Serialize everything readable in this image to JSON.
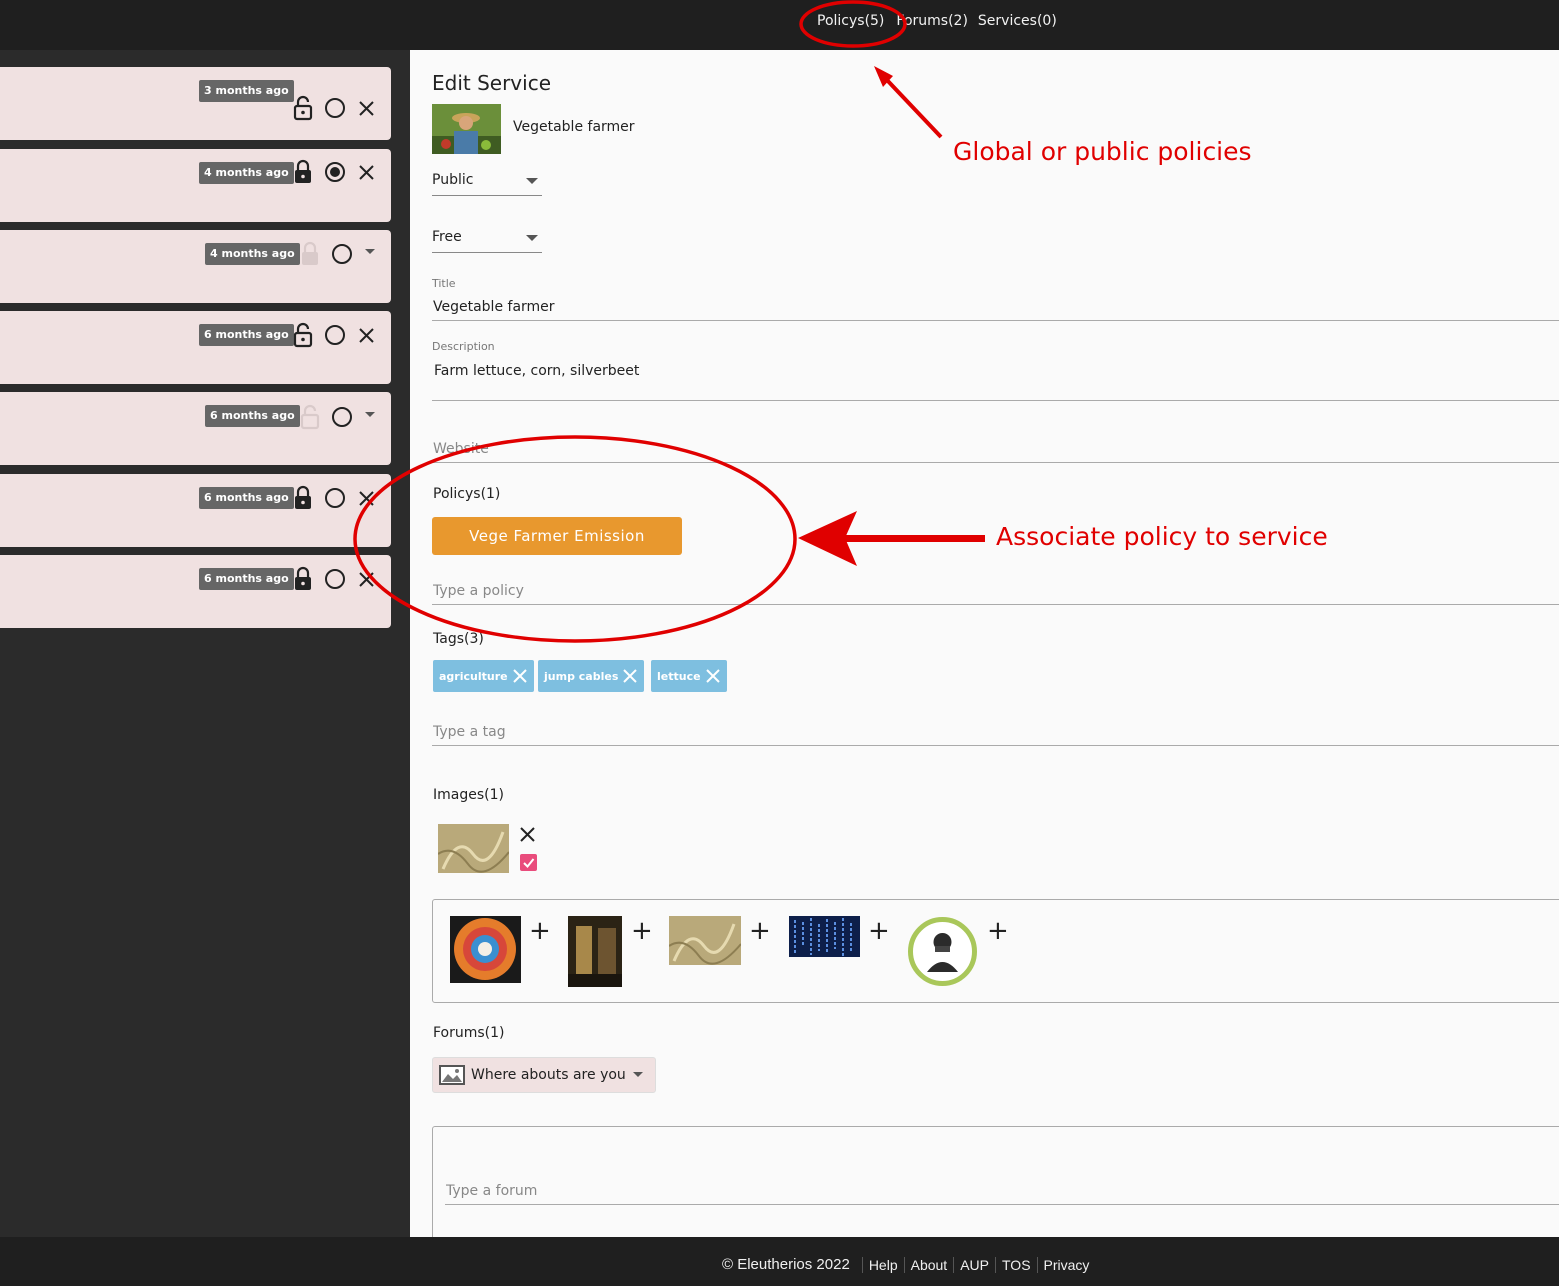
{
  "topnav": {
    "policies": "Policys(5)",
    "forums": "Forums(2)",
    "services": "Services(0)"
  },
  "sidebar": {
    "cards": [
      {
        "age": "3 months ago",
        "lock": "unlocked",
        "radio": "empty",
        "action": "close"
      },
      {
        "age": "4 months ago",
        "lock": "locked",
        "radio": "selected",
        "action": "close"
      },
      {
        "age": "4 months ago",
        "lock": "faded",
        "radio": "empty",
        "action": "dropdown"
      },
      {
        "age": "6 months ago",
        "lock": "unlocked",
        "radio": "empty",
        "action": "close"
      },
      {
        "age": "6 months ago",
        "lock": "faded",
        "radio": "empty",
        "action": "dropdown"
      },
      {
        "age": "6 months ago",
        "lock": "locked",
        "radio": "empty",
        "action": "close"
      },
      {
        "age": "6 months ago",
        "lock": "locked",
        "radio": "empty",
        "action": "close"
      }
    ]
  },
  "edit": {
    "heading": "Edit Service",
    "service_name": "Vegetable farmer",
    "visibility": "Public",
    "pricing": "Free",
    "title_label": "Title",
    "title_value": "Vegetable farmer",
    "description_label": "Description",
    "description_value": "Farm lettuce, corn, silverbeet",
    "website_placeholder": "Website",
    "policies_label": "Policys(1)",
    "policy_button": "Vege Farmer Emission",
    "policy_placeholder": "Type a policy",
    "tags_label": "Tags(3)",
    "tags": [
      "agriculture",
      "jump cables",
      "lettuce"
    ],
    "tag_placeholder": "Type a tag",
    "images_label": "Images(1)",
    "forums_label": "Forums(1)",
    "forum_selected": "Where abouts are you",
    "forum_placeholder": "Type a forum"
  },
  "footer": {
    "copyright": "© Eleutherios 2022",
    "links": [
      "Help",
      "About",
      "AUP",
      "TOS",
      "Privacy"
    ]
  },
  "annotations": {
    "global_policies": "Global or public policies",
    "associate_policy": "Associate policy to service"
  },
  "colors": {
    "annotation": "#e00000",
    "policy_button": "#e8982e",
    "tag": "#7ebfe0",
    "card": "#f0e1e1"
  }
}
